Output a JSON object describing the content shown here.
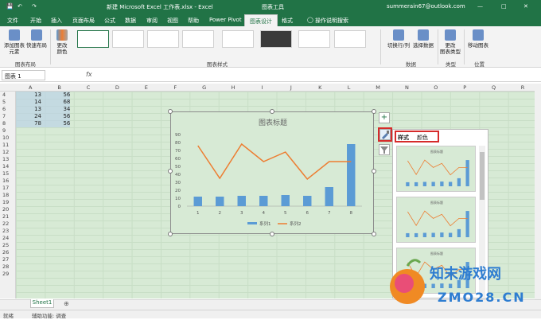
{
  "titlebar": {
    "filename": "新建 Microsoft Excel 工作表.xlsx  -  Excel",
    "context_tool": "图表工具",
    "account": "summerain67@outlook.com"
  },
  "tabs": [
    "文件",
    "开始",
    "插入",
    "页面布局",
    "公式",
    "数据",
    "审阅",
    "视图",
    "帮助",
    "Power Pivot",
    "图表设计",
    "格式"
  ],
  "tell_me": "操作说明搜索",
  "ribbon": {
    "add_element": "添加图表\n元素",
    "quick_layout": "快速布局",
    "change_colors": "更改\n颜色",
    "group_layout": "图表布局",
    "group_styles": "图表样式",
    "switch_row_col": "切换行/列",
    "select_data": "选择数据",
    "group_data": "数据",
    "change_type": "更改\n图表类型",
    "group_type": "类型",
    "move_chart": "移动图表",
    "group_location": "位置"
  },
  "formula": {
    "namebox": "图表 1",
    "fx": "fx"
  },
  "columns": [
    "A",
    "B",
    "C",
    "D",
    "E",
    "F",
    "G",
    "H",
    "I",
    "J",
    "K",
    "L",
    "M",
    "N",
    "O",
    "P",
    "Q",
    "R"
  ],
  "rows": [
    "4",
    "5",
    "6",
    "7",
    "8",
    "9",
    "10",
    "11",
    "12",
    "13",
    "14",
    "15",
    "16",
    "17",
    "18",
    "19",
    "20",
    "21",
    "22",
    "23",
    "24",
    "25",
    "26",
    "27",
    "28",
    "29"
  ],
  "cells": [
    [
      "13",
      "56"
    ],
    [
      "14",
      "68"
    ],
    [
      "13",
      "34"
    ],
    [
      "24",
      "56"
    ],
    [
      "78",
      "56"
    ]
  ],
  "chart_data": {
    "type": "bar",
    "title": "图表标题",
    "categories": [
      "1",
      "2",
      "3",
      "4",
      "5",
      "6",
      "7",
      "8"
    ],
    "series": [
      {
        "name": "系列1",
        "kind": "bar",
        "values": [
          12,
          12,
          13,
          13,
          14,
          13,
          24,
          78
        ]
      },
      {
        "name": "系列2",
        "kind": "line",
        "values": [
          76,
          35,
          78,
          56,
          68,
          34,
          56,
          56
        ]
      }
    ],
    "ylim": [
      0,
      90
    ],
    "yticks": [
      "0",
      "10",
      "20",
      "30",
      "40",
      "50",
      "60",
      "70",
      "80",
      "90"
    ],
    "colors": {
      "bar": "#5b9bd5",
      "line": "#ed7d31"
    },
    "legend": "bottom",
    "grid": false
  },
  "side_buttons": {
    "plus": "+",
    "brush": "brush-icon",
    "filter": "filter-icon"
  },
  "panel": {
    "tab_style": "样式",
    "tab_color": "颜色",
    "thumb_titles": [
      "图表标题",
      "图表标题",
      "图表标题"
    ]
  },
  "sheet_tab": "Sheet1",
  "status": {
    "ready": "就绪",
    "accessibility": "辅助功能: 调查"
  },
  "watermark": {
    "text1": "知末游戏网",
    "text2": "ZMO28.CN"
  }
}
